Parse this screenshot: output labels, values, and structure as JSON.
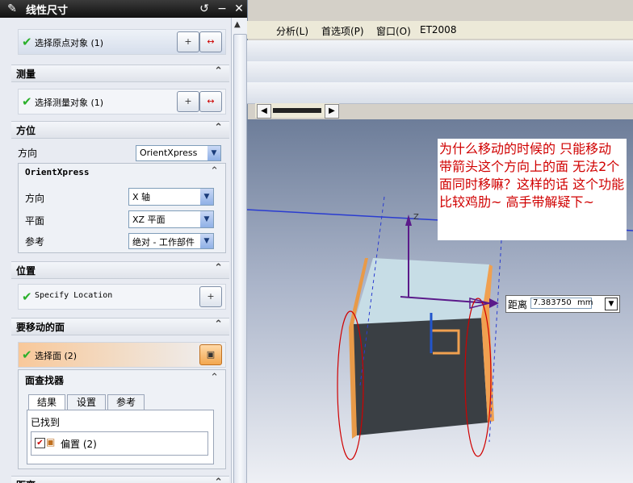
{
  "dialog": {
    "title": "线性尺寸",
    "sections": {
      "origin": {
        "label": "选择原点对象 (1)"
      },
      "measure": {
        "header": "测量",
        "label": "选择测量对象 (1)"
      },
      "orientation": {
        "header": "方位",
        "direction_label": "方向",
        "direction_value": "OrientXpress",
        "sub_header": "OrientXpress",
        "sub_direction_label": "方向",
        "sub_direction_value": "X 轴",
        "plane_label": "平面",
        "plane_value": "XZ 平面",
        "reference_label": "参考",
        "reference_value": "绝对 - 工作部件"
      },
      "location": {
        "header": "位置",
        "label": "Specify Location"
      },
      "faces": {
        "header": "要移动的面",
        "label": "选择面 (2)",
        "finder_header": "面查找器",
        "tabs": [
          "结果",
          "设置",
          "参考"
        ],
        "found_label": "已找到",
        "found_item": "偏置 (2)"
      },
      "bottom_header": "距离"
    }
  },
  "app": {
    "menus": [
      "分析(L)",
      "首选项(P)",
      "窗口(O)",
      "ET2008"
    ]
  },
  "annotation": "为什么移动的时候的 只能移动 带箭头这个方向上的面 无法2个面同时移嘛？这样的话 这个功能比较鸡肋~ 高手带解疑下~",
  "distance": {
    "label": "距离",
    "value": "7.383750",
    "unit": "mm"
  },
  "axis_label": "Z",
  "colors": {
    "accent_orange": "#f0a050",
    "annotation_red": "#d00000",
    "check_green": "#2bb02b"
  }
}
